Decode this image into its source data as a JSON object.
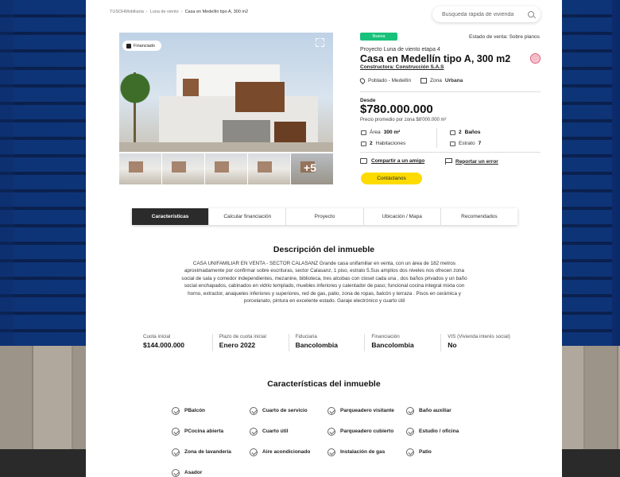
{
  "breadcrumb": {
    "home": "TUSOHMobiliaria",
    "project": "Luna de viento",
    "current": "Casa en Medellín tipo A, 300 m2"
  },
  "search": {
    "placeholder": "Busqueda rápida de vivienda"
  },
  "gallery": {
    "badge": "Financiado",
    "more": "+5"
  },
  "listing": {
    "tag": "Nueva",
    "estado": "Estado de venta: Sobre planos",
    "proyecto": "Proyecto Luna de viento etapa 4",
    "titulo": "Casa en Medellín tipo A, 300 m2",
    "constructora": "Constructora: Construcción S.A.S",
    "barrio": "Poblado - Medellín",
    "zona_label": "Zona",
    "zona_value": "Urbana",
    "desde": "Desde",
    "precio": "$780.000.000",
    "promedio": "Precio promedio por zona $8'000.000 m²",
    "area_label": "Área",
    "area_value": "300 m²",
    "banos_value": "2",
    "banos_label": "Baños",
    "habitaciones_value": "2",
    "habitaciones_label": "Habitaciones",
    "estrato_label": "Estrato",
    "estrato_value": "7",
    "compartir": "Compartir a un amigo",
    "reportar": "Reportar un error",
    "contactanos": "Contáctanos"
  },
  "tabs": [
    {
      "label": "Características"
    },
    {
      "label": "Calcular financiación"
    },
    {
      "label": "Proyecto"
    },
    {
      "label": "Ubicación / Mapa"
    },
    {
      "label": "Recomendados"
    }
  ],
  "descripcion": {
    "title": "Descripción del inmueble",
    "text": "CASA UNIFAMILIAR EN VENTA - SECTOR CALASANZ Grande casa unifamiliar en venta, con un área de 182 metros aproximadamente por confirmar sobre escrituras, sector Calasanz, 1 piso, estrato 5.Sus amplios dos niveles nos ofrecen zona social de sala y comedor independientes, mezanine, biblioteca, tres alcobas con closet cada una , dos baños privados y un baño social enchapados, cabinados en vidrio templado, muebles inferiores y calentador de paso; funcional cocina integral mixta con horno, extractor, anaqueles inferiores y superiores, red de gas, patio, zona de ropas, balcón y terraza . Pisos en cerámica y porcelanato, pintura en excelente estado. Garaje electrónico y cuarto útil"
  },
  "finance": [
    {
      "label": "Cuota inicial",
      "value": "$144.000.000"
    },
    {
      "label": "Plazo de cuota inicial",
      "value": "Enero 2022"
    },
    {
      "label": "Fiduciaria",
      "value": "Bancolombia"
    },
    {
      "label": "Financiación",
      "value": "Bancolombia"
    },
    {
      "label": "VIS (Vivienda interés social)",
      "value": "No"
    }
  ],
  "caracteristicas": {
    "title": "Características del inmueble",
    "items": [
      "PBalcón",
      "Cuarto de servicio",
      "Parqueadero visitante",
      "Baño auxiliar",
      "PCocina abierta",
      "Cuarto útil",
      "Parqueadero cubierto",
      "Estudio / oficina",
      "Zona de lavandería",
      "Aire acondicionado",
      "Instalación de gas",
      "Patio",
      "Asador"
    ]
  }
}
